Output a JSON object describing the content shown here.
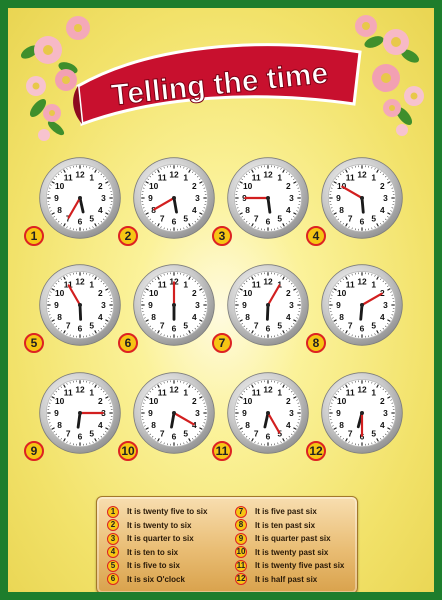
{
  "title": "Telling the time",
  "colors": {
    "border": "#1e7d2c",
    "banner": "#c8102e",
    "badge": "#f6c514",
    "badge_ring": "#dd2222",
    "hand": "#d21f1f"
  },
  "clocks": [
    {
      "label": "1",
      "hour": 5,
      "minute": 35
    },
    {
      "label": "2",
      "hour": 5,
      "minute": 40
    },
    {
      "label": "3",
      "hour": 5,
      "minute": 45
    },
    {
      "label": "4",
      "hour": 5,
      "minute": 50
    },
    {
      "label": "5",
      "hour": 5,
      "minute": 55
    },
    {
      "label": "6",
      "hour": 6,
      "minute": 0
    },
    {
      "label": "7",
      "hour": 6,
      "minute": 5
    },
    {
      "label": "8",
      "hour": 6,
      "minute": 10
    },
    {
      "label": "9",
      "hour": 6,
      "minute": 15
    },
    {
      "label": "10",
      "hour": 6,
      "minute": 20
    },
    {
      "label": "11",
      "hour": 6,
      "minute": 25
    },
    {
      "label": "12",
      "hour": 6,
      "minute": 30
    }
  ],
  "answers": [
    {
      "num": "1",
      "text": "It is twenty five to six"
    },
    {
      "num": "2",
      "text": "It is twenty to six"
    },
    {
      "num": "3",
      "text": "It is quarter to six"
    },
    {
      "num": "4",
      "text": "It is ten to six"
    },
    {
      "num": "5",
      "text": "It is five to six"
    },
    {
      "num": "6",
      "text": "It is six O'clock"
    },
    {
      "num": "7",
      "text": "It is five past six"
    },
    {
      "num": "8",
      "text": "It is ten past six"
    },
    {
      "num": "9",
      "text": "It is quarter past six"
    },
    {
      "num": "10",
      "text": "It is twenty past six"
    },
    {
      "num": "11",
      "text": "It is twenty five past six"
    },
    {
      "num": "12",
      "text": "It is half past six"
    }
  ]
}
